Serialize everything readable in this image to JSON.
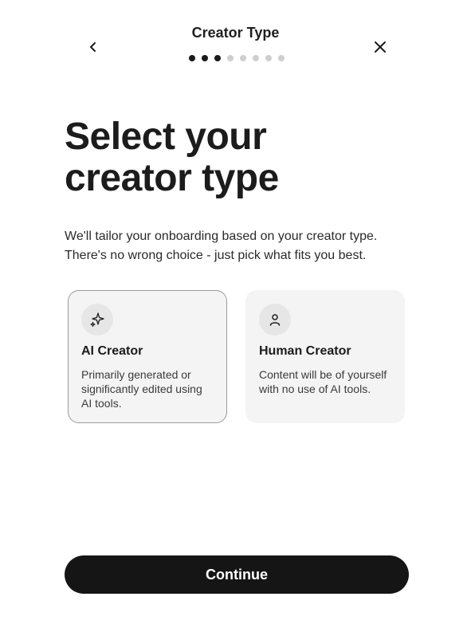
{
  "header": {
    "title": "Creator Type",
    "back_icon": "chevron-left-icon",
    "close_icon": "close-icon",
    "progress": {
      "current_step": 3,
      "total_steps": 8
    }
  },
  "main": {
    "title_line1": "Select your",
    "title_line2": "creator type",
    "subtitle_line1": "We'll tailor your onboarding based on your creator type.",
    "subtitle_line2": "There's no wrong choice - just pick what fits you best."
  },
  "options": [
    {
      "title": "AI Creator",
      "description": "Primarily generated or significantly edited using AI tools.",
      "icon": "sparkles-icon",
      "selected": true
    },
    {
      "title": "Human Creator",
      "description": "Content will be of yourself with no use of AI tools.",
      "icon": "person-icon",
      "selected": false
    }
  ],
  "footer": {
    "continue_label": "Continue"
  },
  "colors": {
    "primary_button": "#151515",
    "card_background": "#f4f4f4",
    "selected_border": "#9a9a9a",
    "dot_active": "#1a1a1a",
    "dot_inactive": "#cfcfcf"
  }
}
